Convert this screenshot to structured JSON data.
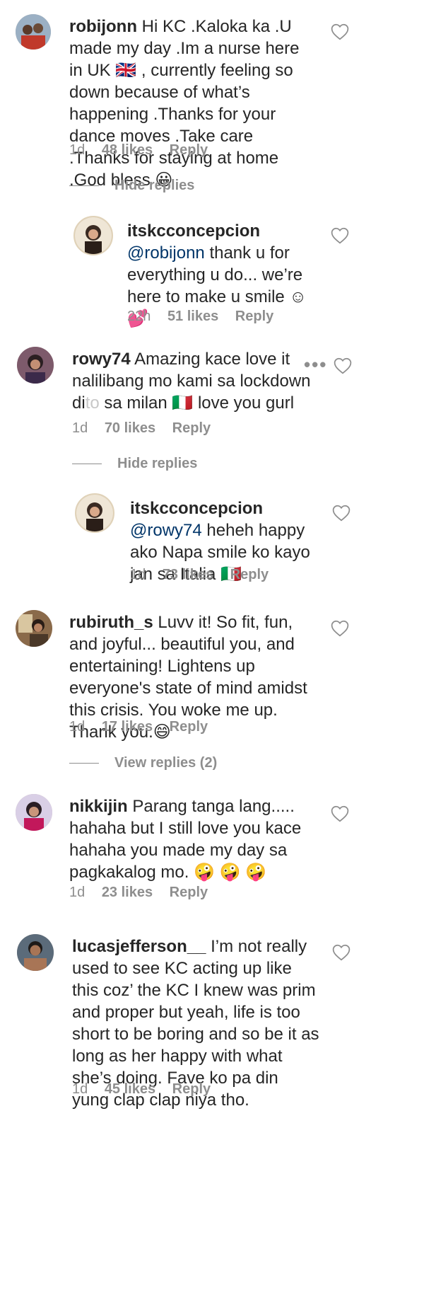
{
  "comments": [
    {
      "username": "robijonn",
      "text": "Hi KC .Kaloka ka .U made my day .Im a nurse here in UK 🇬🇧 , currently feeling so down because of what’s happening .Thanks for your dance moves .Take care .Thanks for staying at home .God bless 😀",
      "time": "1d",
      "likes": "48 likes",
      "reply": "Reply",
      "toggle": "Hide replies",
      "reply_item": {
        "username": "itskcconcepcion",
        "mention": "@robijonn",
        "text": "thank u for everything u do... we’re here to make u smile ☺💕",
        "time": "22h",
        "likes": "51 likes",
        "reply": "Reply"
      }
    },
    {
      "username": "rowy74",
      "text_before": "Amazing kace love it nalilibang mo kami sa lockdown di",
      "text_faded": "to",
      "text_after": "sa milan 🇮🇹 love you gurl",
      "time": "1d",
      "likes": "70 likes",
      "reply": "Reply",
      "toggle": "Hide replies",
      "dots": "•••",
      "reply_item": {
        "username": "itskcconcepcion",
        "mention": "@rowy74",
        "text": "heheh happy ako Napa smile ko kayo jan sa Italia 🇮🇹",
        "time": "1d",
        "likes": "73 likes",
        "reply": "Reply"
      }
    },
    {
      "username": "rubiruth_s",
      "text": "Luvv it! So fit, fun, and joyful... beautiful you, and entertaining! Lightens up everyone's state of mind amidst this crisis. You woke me up. Thank you.😄",
      "time": "1d",
      "likes": "17 likes",
      "reply": "Reply",
      "toggle": "View replies (2)"
    },
    {
      "username": "nikkijin",
      "text": "Parang tanga lang..... hahaha but I still love you kace hahaha you made my day sa pagkakalog mo. 🤪 🤪 🤪",
      "time": "1d",
      "likes": "23 likes",
      "reply": "Reply"
    },
    {
      "username": "lucasjefferson__",
      "text": "I’m not really used to see KC acting up like this coz’ the KC I knew was prim and proper but yeah, life is too short to be boring and so be it as long as her happy with what she’s doing. Fave ko pa din yung clap clap niya tho.",
      "time": "1d",
      "likes": "45 likes",
      "reply": "Reply"
    }
  ],
  "colors": {
    "text": "#262626",
    "meta": "#8e8e8e",
    "mention": "#003569"
  },
  "icons": {
    "like": "heart-outline-icon",
    "more": "more-options-icon"
  }
}
